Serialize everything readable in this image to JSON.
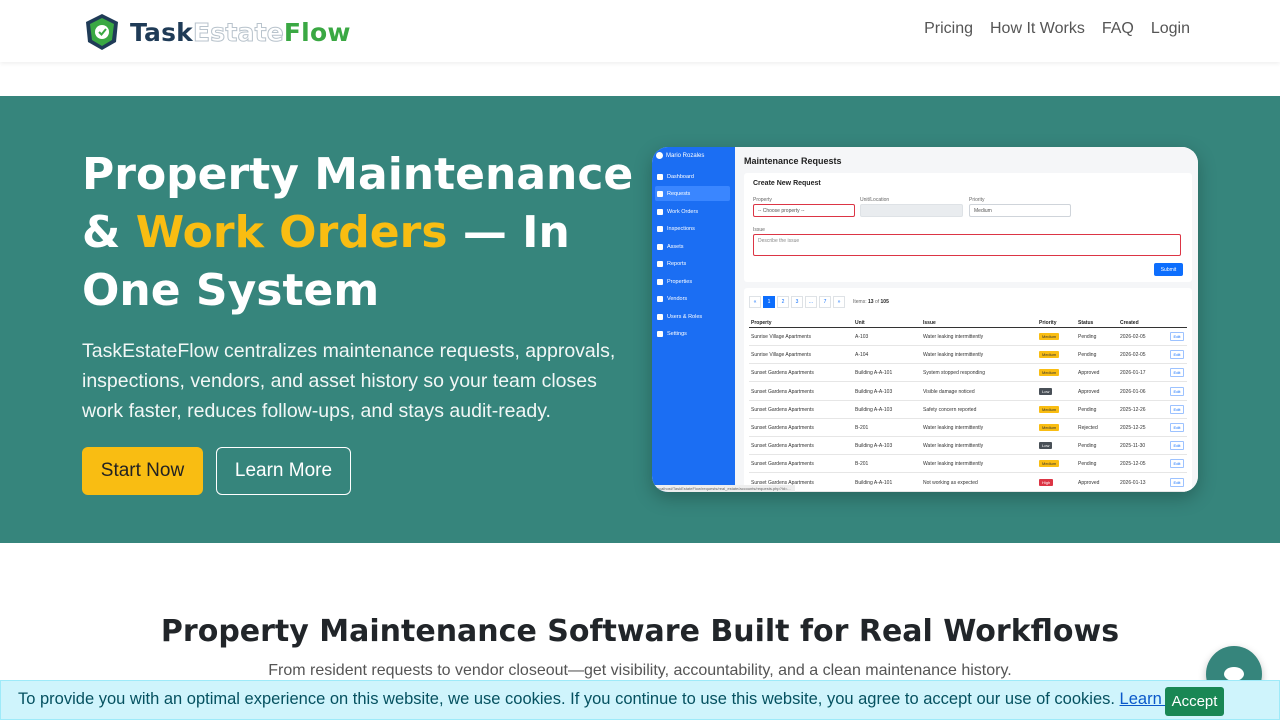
{
  "header": {
    "logo_part1": "Task",
    "logo_part2": "Estate",
    "logo_part3": "Flow",
    "nav": [
      "Pricing",
      "How It Works",
      "FAQ",
      "Login"
    ]
  },
  "hero": {
    "title_line1": "Property Maintenance",
    "title_amp": "& ",
    "title_accent": "Work Orders",
    "title_rest": " — In One System",
    "subtitle": "TaskEstateFlow centralizes maintenance requests, approvals, inspections, vendors, and asset history so your team closes work faster, reduces follow-ups, and stays audit-ready.",
    "start_label": "Start Now",
    "learn_label": "Learn More"
  },
  "app": {
    "user": "Mario Rozales",
    "sidebar": [
      "Dashboard",
      "Requests",
      "Work Orders",
      "Inspections",
      "Assets",
      "Reports",
      "Properties",
      "Vendors",
      "Users & Roles",
      "Settings"
    ],
    "page_title": "Maintenance Requests",
    "form": {
      "title": "Create New Request",
      "property_label": "Property",
      "property_value": "-- Choose property --",
      "unit_label": "Unit/Location",
      "priority_label": "Priority",
      "priority_value": "Medium",
      "issue_label": "Issue",
      "issue_placeholder": "Describe the issue",
      "submit": "Submit"
    },
    "pager": [
      "«",
      "1",
      "2",
      "3",
      "...",
      "7",
      "»"
    ],
    "items_prefix": "Items",
    "items_range": "13",
    "items_of": "of",
    "items_total": "105",
    "columns": [
      "Property",
      "Unit",
      "Issue",
      "Priority",
      "Status",
      "Created"
    ],
    "rows": [
      {
        "property": "Sunrise Village Apartments",
        "unit": "A-103",
        "issue": "Water leaking intermittently",
        "priority": "Medium",
        "status": "Pending",
        "created": "2026-02-05"
      },
      {
        "property": "Sunrise Village Apartments",
        "unit": "A-104",
        "issue": "Water leaking intermittently",
        "priority": "Medium",
        "status": "Pending",
        "created": "2026-02-05"
      },
      {
        "property": "Sunset Gardens Apartments",
        "unit": "Building A-A-101",
        "issue": "System stopped responding",
        "priority": "Medium",
        "status": "Approved",
        "created": "2026-01-17"
      },
      {
        "property": "Sunset Gardens Apartments",
        "unit": "Building A-A-103",
        "issue": "Visible damage noticed",
        "priority": "Low",
        "status": "Approved",
        "created": "2026-01-06"
      },
      {
        "property": "Sunset Gardens Apartments",
        "unit": "Building A-A-103",
        "issue": "Safety concern reported",
        "priority": "Medium",
        "status": "Pending",
        "created": "2025-12-26"
      },
      {
        "property": "Sunset Gardens Apartments",
        "unit": "B-201",
        "issue": "Water leaking intermittently",
        "priority": "Medium",
        "status": "Rejected",
        "created": "2025-12-25"
      },
      {
        "property": "Sunset Gardens Apartments",
        "unit": "Building A-A-103",
        "issue": "Water leaking intermittently",
        "priority": "Low",
        "status": "Pending",
        "created": "2025-11-30"
      },
      {
        "property": "Sunset Gardens Apartments",
        "unit": "B-201",
        "issue": "Water leaking intermittently",
        "priority": "Medium",
        "status": "Pending",
        "created": "2025-12-05"
      },
      {
        "property": "Sunset Gardens Apartments",
        "unit": "Building A-A-101",
        "issue": "Not working as expected",
        "priority": "High",
        "status": "Approved",
        "created": "2026-01-13"
      }
    ],
    "edit_label": "Edit",
    "status_url": "localhost/TaskEstateFlow/requests/real_estate/accounts/requests.php?id=..."
  },
  "features": {
    "title": "Property Maintenance Software Built for Real Workflows",
    "subtitle": "From resident requests to vendor closeout—get visibility, accountability, and a clean maintenance history."
  },
  "cookie": {
    "text": "To provide you with an optimal experience on this website, we use cookies. If you continue to use this website, you agree to accept our use of cookies.",
    "link": "Learn more",
    "accept": "Accept"
  },
  "colors": {
    "hero_bg": "#36857c",
    "accent": "#f9bd12",
    "app_sidebar": "#1b6ef3",
    "badge_medium": "#f9bd12",
    "badge_low": "#495057",
    "badge_high": "#dc3545",
    "accept_button": "#198754"
  },
  "icons": [
    "logo-icon",
    "chat-icon"
  ]
}
